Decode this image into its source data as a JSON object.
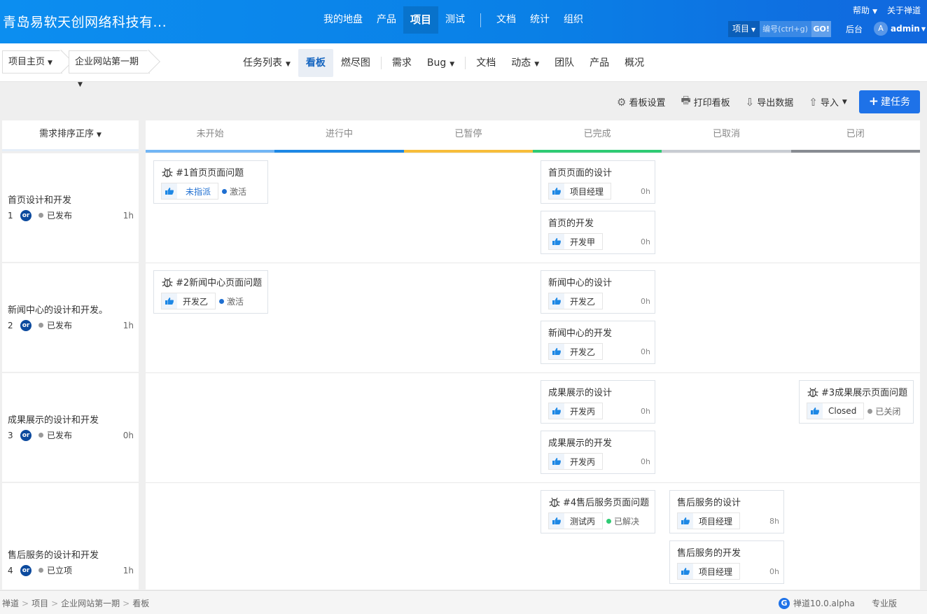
{
  "header": {
    "brand": "青岛易软天创网络科技有...",
    "nav": [
      {
        "label": "我的地盘",
        "active": false
      },
      {
        "label": "产品",
        "active": false
      },
      {
        "label": "项目",
        "active": true
      },
      {
        "label": "测试",
        "active": false
      },
      {
        "label": "文档",
        "active": false
      },
      {
        "label": "统计",
        "active": false
      },
      {
        "label": "组织",
        "active": false
      }
    ],
    "help": "帮助",
    "about": "关于禅道",
    "search_type": "项目",
    "search_placeholder": "编号(ctrl+g)",
    "go": "GO!",
    "backend": "后台",
    "avatar_letter": "A",
    "user": "admin"
  },
  "subnav": {
    "crumbs": [
      "项目主页",
      "企业网站第一期"
    ],
    "items": [
      {
        "label": "任务列表",
        "dropdown": true,
        "active": false
      },
      {
        "label": "看板",
        "dropdown": false,
        "active": true
      },
      {
        "label": "燃尽图",
        "dropdown": false,
        "active": false
      },
      {
        "label": "需求",
        "dropdown": false,
        "active": false
      },
      {
        "label": "Bug",
        "dropdown": true,
        "active": false
      },
      {
        "label": "文档",
        "dropdown": false,
        "active": false
      },
      {
        "label": "动态",
        "dropdown": true,
        "active": false
      },
      {
        "label": "团队",
        "dropdown": false,
        "active": false
      },
      {
        "label": "产品",
        "dropdown": false,
        "active": false
      },
      {
        "label": "概况",
        "dropdown": false,
        "active": false
      }
    ]
  },
  "toolbar": {
    "settings": "看板设置",
    "print": "打印看板",
    "export": "导出数据",
    "import": "导入",
    "create": "建任务",
    "icons": {
      "settings": "gear-icon",
      "print": "printer-icon",
      "export": "download-icon",
      "import": "upload-icon",
      "create": "plus-icon"
    }
  },
  "board": {
    "sort_label": "需求排序正序",
    "columns": [
      {
        "label": "未开始",
        "color": "#72b6f5"
      },
      {
        "label": "进行中",
        "color": "#1e88e5"
      },
      {
        "label": "已暂停",
        "color": "#f7bd3a"
      },
      {
        "label": "已完成",
        "color": "#2fcb74"
      },
      {
        "label": "已取消",
        "color": "#c8ccd2"
      },
      {
        "label": "已闭",
        "color": "#888c92"
      }
    ],
    "lanes": [
      {
        "title": "首页设计和开发",
        "num": "1",
        "owner": "or",
        "status": "已发布",
        "estimate": "1h",
        "cards": [
          {
            "col": 0,
            "row": 0,
            "bug": true,
            "title": "#1首页页面问题",
            "who": "未指派",
            "unassigned": true,
            "status": "激活",
            "status_color": "#1f6fd1",
            "hours": ""
          },
          {
            "col": 3,
            "row": 0,
            "bug": false,
            "title": "首页页面的设计",
            "who": "项目经理",
            "unassigned": false,
            "status": "",
            "status_color": "",
            "hours": "0h"
          },
          {
            "col": 3,
            "row": 1,
            "bug": false,
            "title": "首页的开发",
            "who": "开发甲",
            "unassigned": false,
            "status": "",
            "status_color": "",
            "hours": "0h"
          }
        ]
      },
      {
        "title": "新闻中心的设计和开发。",
        "num": "2",
        "owner": "or",
        "status": "已发布",
        "estimate": "1h",
        "cards": [
          {
            "col": 0,
            "row": 0,
            "bug": true,
            "title": "#2新闻中心页面问题",
            "who": "开发乙",
            "unassigned": false,
            "status": "激活",
            "status_color": "#1f6fd1",
            "hours": ""
          },
          {
            "col": 3,
            "row": 0,
            "bug": false,
            "title": "新闻中心的设计",
            "who": "开发乙",
            "unassigned": false,
            "status": "",
            "status_color": "",
            "hours": "0h"
          },
          {
            "col": 3,
            "row": 1,
            "bug": false,
            "title": "新闻中心的开发",
            "who": "开发乙",
            "unassigned": false,
            "status": "",
            "status_color": "",
            "hours": "0h"
          }
        ]
      },
      {
        "title": "成果展示的设计和开发",
        "num": "3",
        "owner": "or",
        "status": "已发布",
        "estimate": "0h",
        "cards": [
          {
            "col": 3,
            "row": 0,
            "bug": false,
            "title": "成果展示的设计",
            "who": "开发丙",
            "unassigned": false,
            "status": "",
            "status_color": "",
            "hours": "0h"
          },
          {
            "col": 3,
            "row": 1,
            "bug": false,
            "title": "成果展示的开发",
            "who": "开发丙",
            "unassigned": false,
            "status": "",
            "status_color": "",
            "hours": "0h"
          },
          {
            "col": 5,
            "row": 0,
            "bug": true,
            "title": "#3成果展示页面问题",
            "who": "Closed",
            "unassigned": false,
            "status": "已关闭",
            "status_color": "#999999",
            "hours": ""
          }
        ]
      },
      {
        "title": "售后服务的设计和开发",
        "num": "4",
        "owner": "or",
        "status": "已立项",
        "estimate": "1h",
        "cards": [
          {
            "col": 3,
            "row": 0,
            "bug": true,
            "title": "#4售后服务页面问题",
            "who": "测试丙",
            "unassigned": false,
            "status": "已解决",
            "status_color": "#2fcb74",
            "hours": ""
          },
          {
            "col": 4,
            "row": 0,
            "bug": false,
            "title": "售后服务的设计",
            "who": "项目经理",
            "unassigned": false,
            "status": "",
            "status_color": "",
            "hours": "8h"
          },
          {
            "col": 4,
            "row": 1,
            "bug": false,
            "title": "售后服务的开发",
            "who": "项目经理",
            "unassigned": false,
            "status": "",
            "status_color": "",
            "hours": "0h"
          }
        ]
      }
    ]
  },
  "footer": {
    "crumbs": [
      "禅道",
      "项目",
      "企业网站第一期",
      "看板"
    ],
    "version": "禅道10.0.alpha",
    "edition": "专业版"
  }
}
